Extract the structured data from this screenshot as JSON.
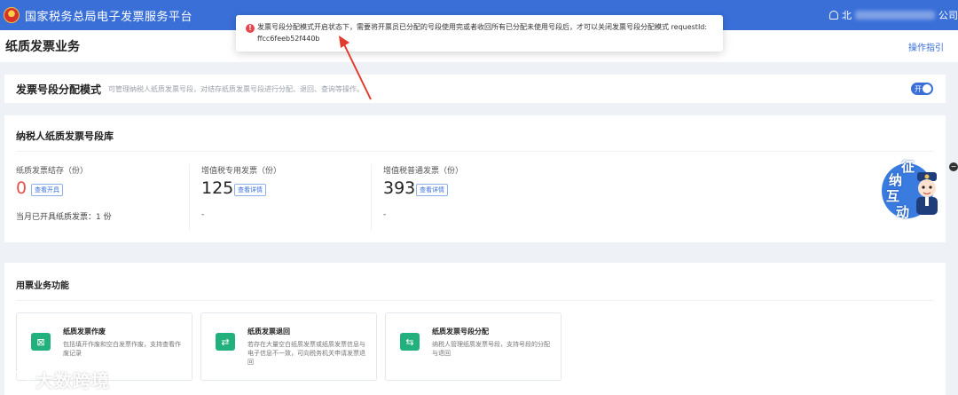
{
  "header": {
    "app_title": "国家税务总局电子发票服务平台",
    "user_prefix": "北",
    "user_suffix": "公司"
  },
  "page": {
    "title": "纸质发票业务",
    "guide_link": "操作指引"
  },
  "mode": {
    "label": "发票号段分配模式",
    "description": "可管理纳税人纸质发票号段，对结存纸质发票号段进行分配、退回、查询等操作。",
    "toggle_label": "开",
    "enabled": true
  },
  "library": {
    "title": "纳税人纸质发票号段库",
    "stats": [
      {
        "label": "纸质发票结存（份）",
        "value": "0",
        "button": "查看开具",
        "footer": "当月已开具纸质发票：1 份"
      },
      {
        "label": "增值税专用发票（份）",
        "value": "125",
        "button": "查看详情",
        "footer": "-"
      },
      {
        "label": "增值税普通发票（份）",
        "value": "393",
        "button": "查看详情",
        "footer": "-"
      }
    ]
  },
  "functions": {
    "title": "用票业务功能",
    "items": [
      {
        "name": "纸质发票作废",
        "description": "包括填开作废和空白发票作废，支持查看作废记录",
        "icon": "void-icon"
      },
      {
        "name": "纸质发票退回",
        "description": "若存在大量空白纸质发票或纸质发票信息与电子信息不一致，可向税务机关申请发票退回",
        "icon": "return-icon"
      },
      {
        "name": "纸质发票号段分配",
        "description": "纳税人管理纸质发票号段，支持号段的分配与退回",
        "icon": "allocate-icon"
      }
    ]
  },
  "toast": {
    "icon": "error-icon",
    "message": "发票号段分配模式开启状态下，需要将开票员已分配的号段使用完或者收回所有已分配未使用号段后，才可以关闭发票号段分配模式 requestId: ffcc6feeb52f440b"
  },
  "mascot": {
    "chars": [
      "征",
      "纳",
      "互",
      "动"
    ]
  },
  "side_collapse": "−",
  "watermark": {
    "text": "大数跨境"
  },
  "colors": {
    "header_blue": "#3a6fd8",
    "accent_green": "#22b07d",
    "error_red": "#e5484d",
    "zero_red": "#e1524a"
  }
}
